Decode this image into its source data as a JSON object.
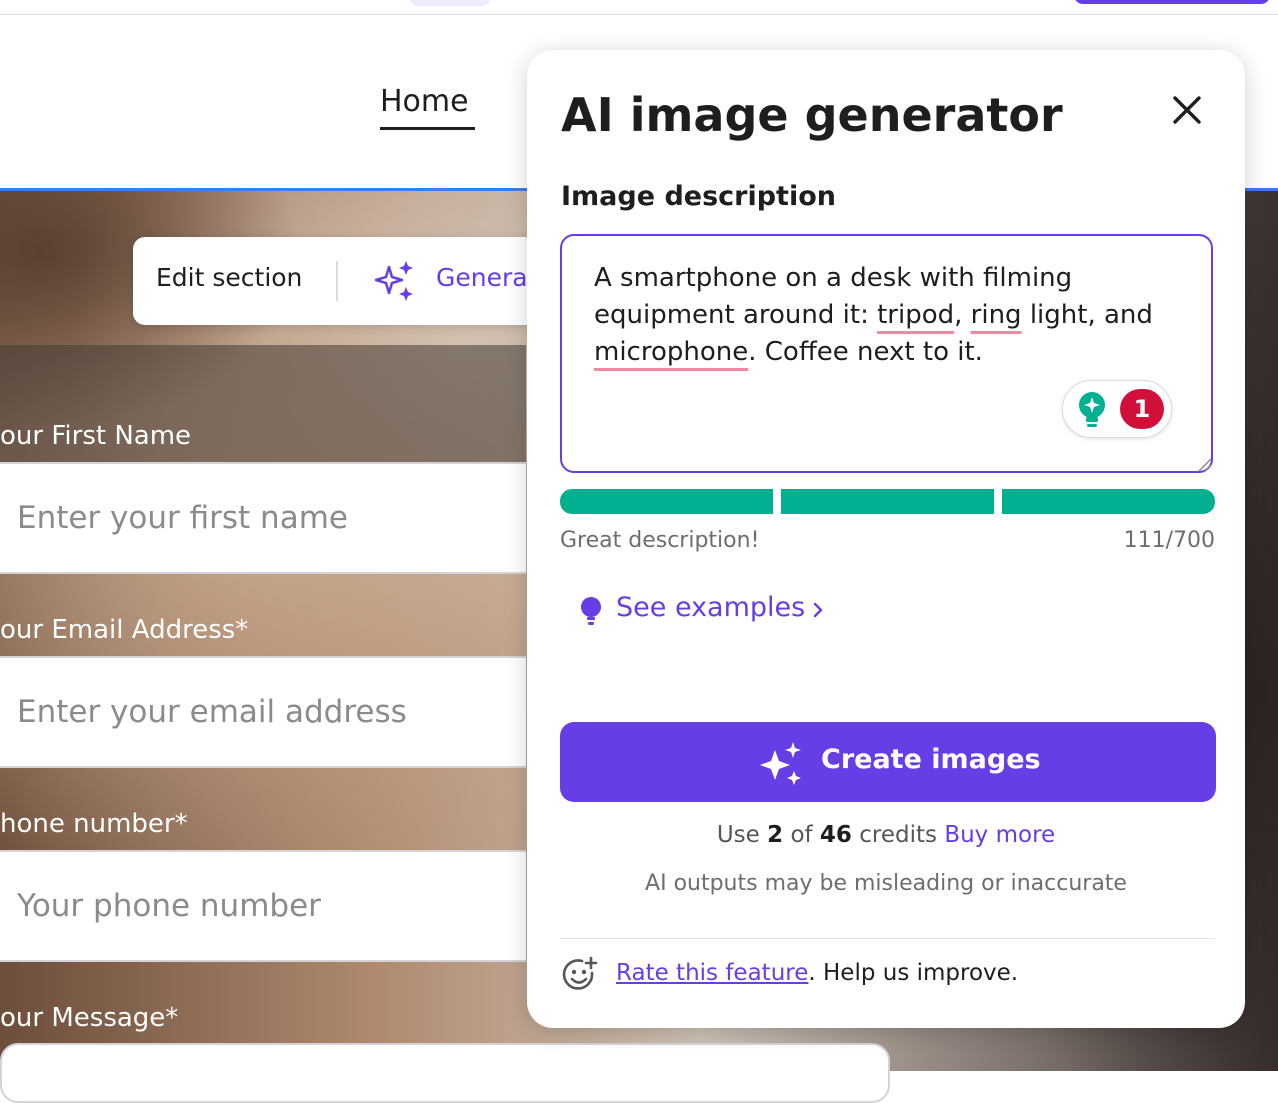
{
  "nav": {
    "home": "Home"
  },
  "editor_toolbar": {
    "edit_section": "Edit section",
    "generate": "Genera"
  },
  "form": {
    "first_name_label": "our First Name",
    "first_name_placeholder": "Enter your first name",
    "email_label": "our Email Address*",
    "email_placeholder": "Enter your email address",
    "phone_label": "hone number*",
    "phone_placeholder": "Your phone number",
    "message_label": "our Message*"
  },
  "panel": {
    "title": "AI image generator",
    "field_label": "Image description",
    "description": {
      "p1": "A smartphone on a desk with filming equipment around it: ",
      "w1": "tripod",
      "p2": ", ",
      "w2": "ring",
      "p3": " light, and ",
      "w3": "microphone",
      "p4": ". Coffee next to it."
    },
    "assistant_badge_count": "1",
    "progress": {
      "segments_total": 3,
      "segments_filled": 3,
      "color": "#00b090"
    },
    "hint": "Great description!",
    "char_count": "111/700",
    "see_examples": "See examples",
    "create_button": "Create images",
    "credits": {
      "prefix": "Use",
      "used": "2",
      "of": "of",
      "total": "46",
      "unit": "credits",
      "buy_more": "Buy more"
    },
    "disclaimer": "AI outputs may be misleading or inaccurate",
    "rate": {
      "link": "Rate this feature",
      "suffix": ". Help us improve."
    }
  },
  "colors": {
    "accent": "#673de6",
    "success": "#00b090",
    "error": "#d0103a",
    "selection_border": "#357df9"
  },
  "icons": [
    "close-icon",
    "sparkle-icon",
    "lightbulb-icon",
    "chevron-right-icon",
    "smiley-icon",
    "resize-handle-icon"
  ]
}
